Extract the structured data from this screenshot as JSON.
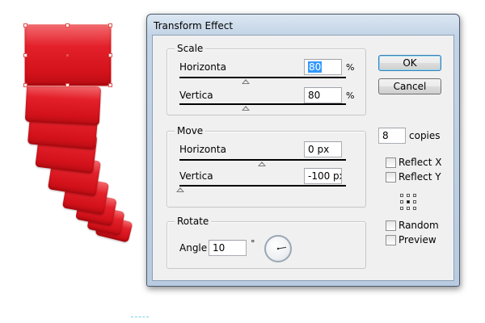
{
  "dialog": {
    "title": "Transform Effect",
    "scale": {
      "group_label": "Scale",
      "horizontal_label": "Horizonta",
      "horizontal_value": "80",
      "horizontal_unit": "%",
      "vertical_label": "Vertica",
      "vertical_value": "80",
      "vertical_unit": "%"
    },
    "move": {
      "group_label": "Move",
      "horizontal_label": "Horizonta",
      "horizontal_value": "0 px",
      "vertical_label": "Vertica",
      "vertical_value": "-100 px"
    },
    "rotate": {
      "group_label": "Rotate",
      "angle_label": "Angle",
      "angle_value": "10",
      "angle_unit": "°"
    },
    "ok_label": "OK",
    "cancel_label": "Cancel",
    "copies_value": "8",
    "copies_label": "copies",
    "reflect_x_label": "Reflect X",
    "reflect_y_label": "Reflect Y",
    "random_label": "Random",
    "preview_label": "Preview"
  },
  "colors": {
    "artwork_red": "#e4212b",
    "selection": "#e05050",
    "selected_text_bg": "#3399ff"
  },
  "icons": [
    "reference-point-icon",
    "angle-dial-icon",
    "checkbox-icon",
    "slider-thumb-icon"
  ]
}
